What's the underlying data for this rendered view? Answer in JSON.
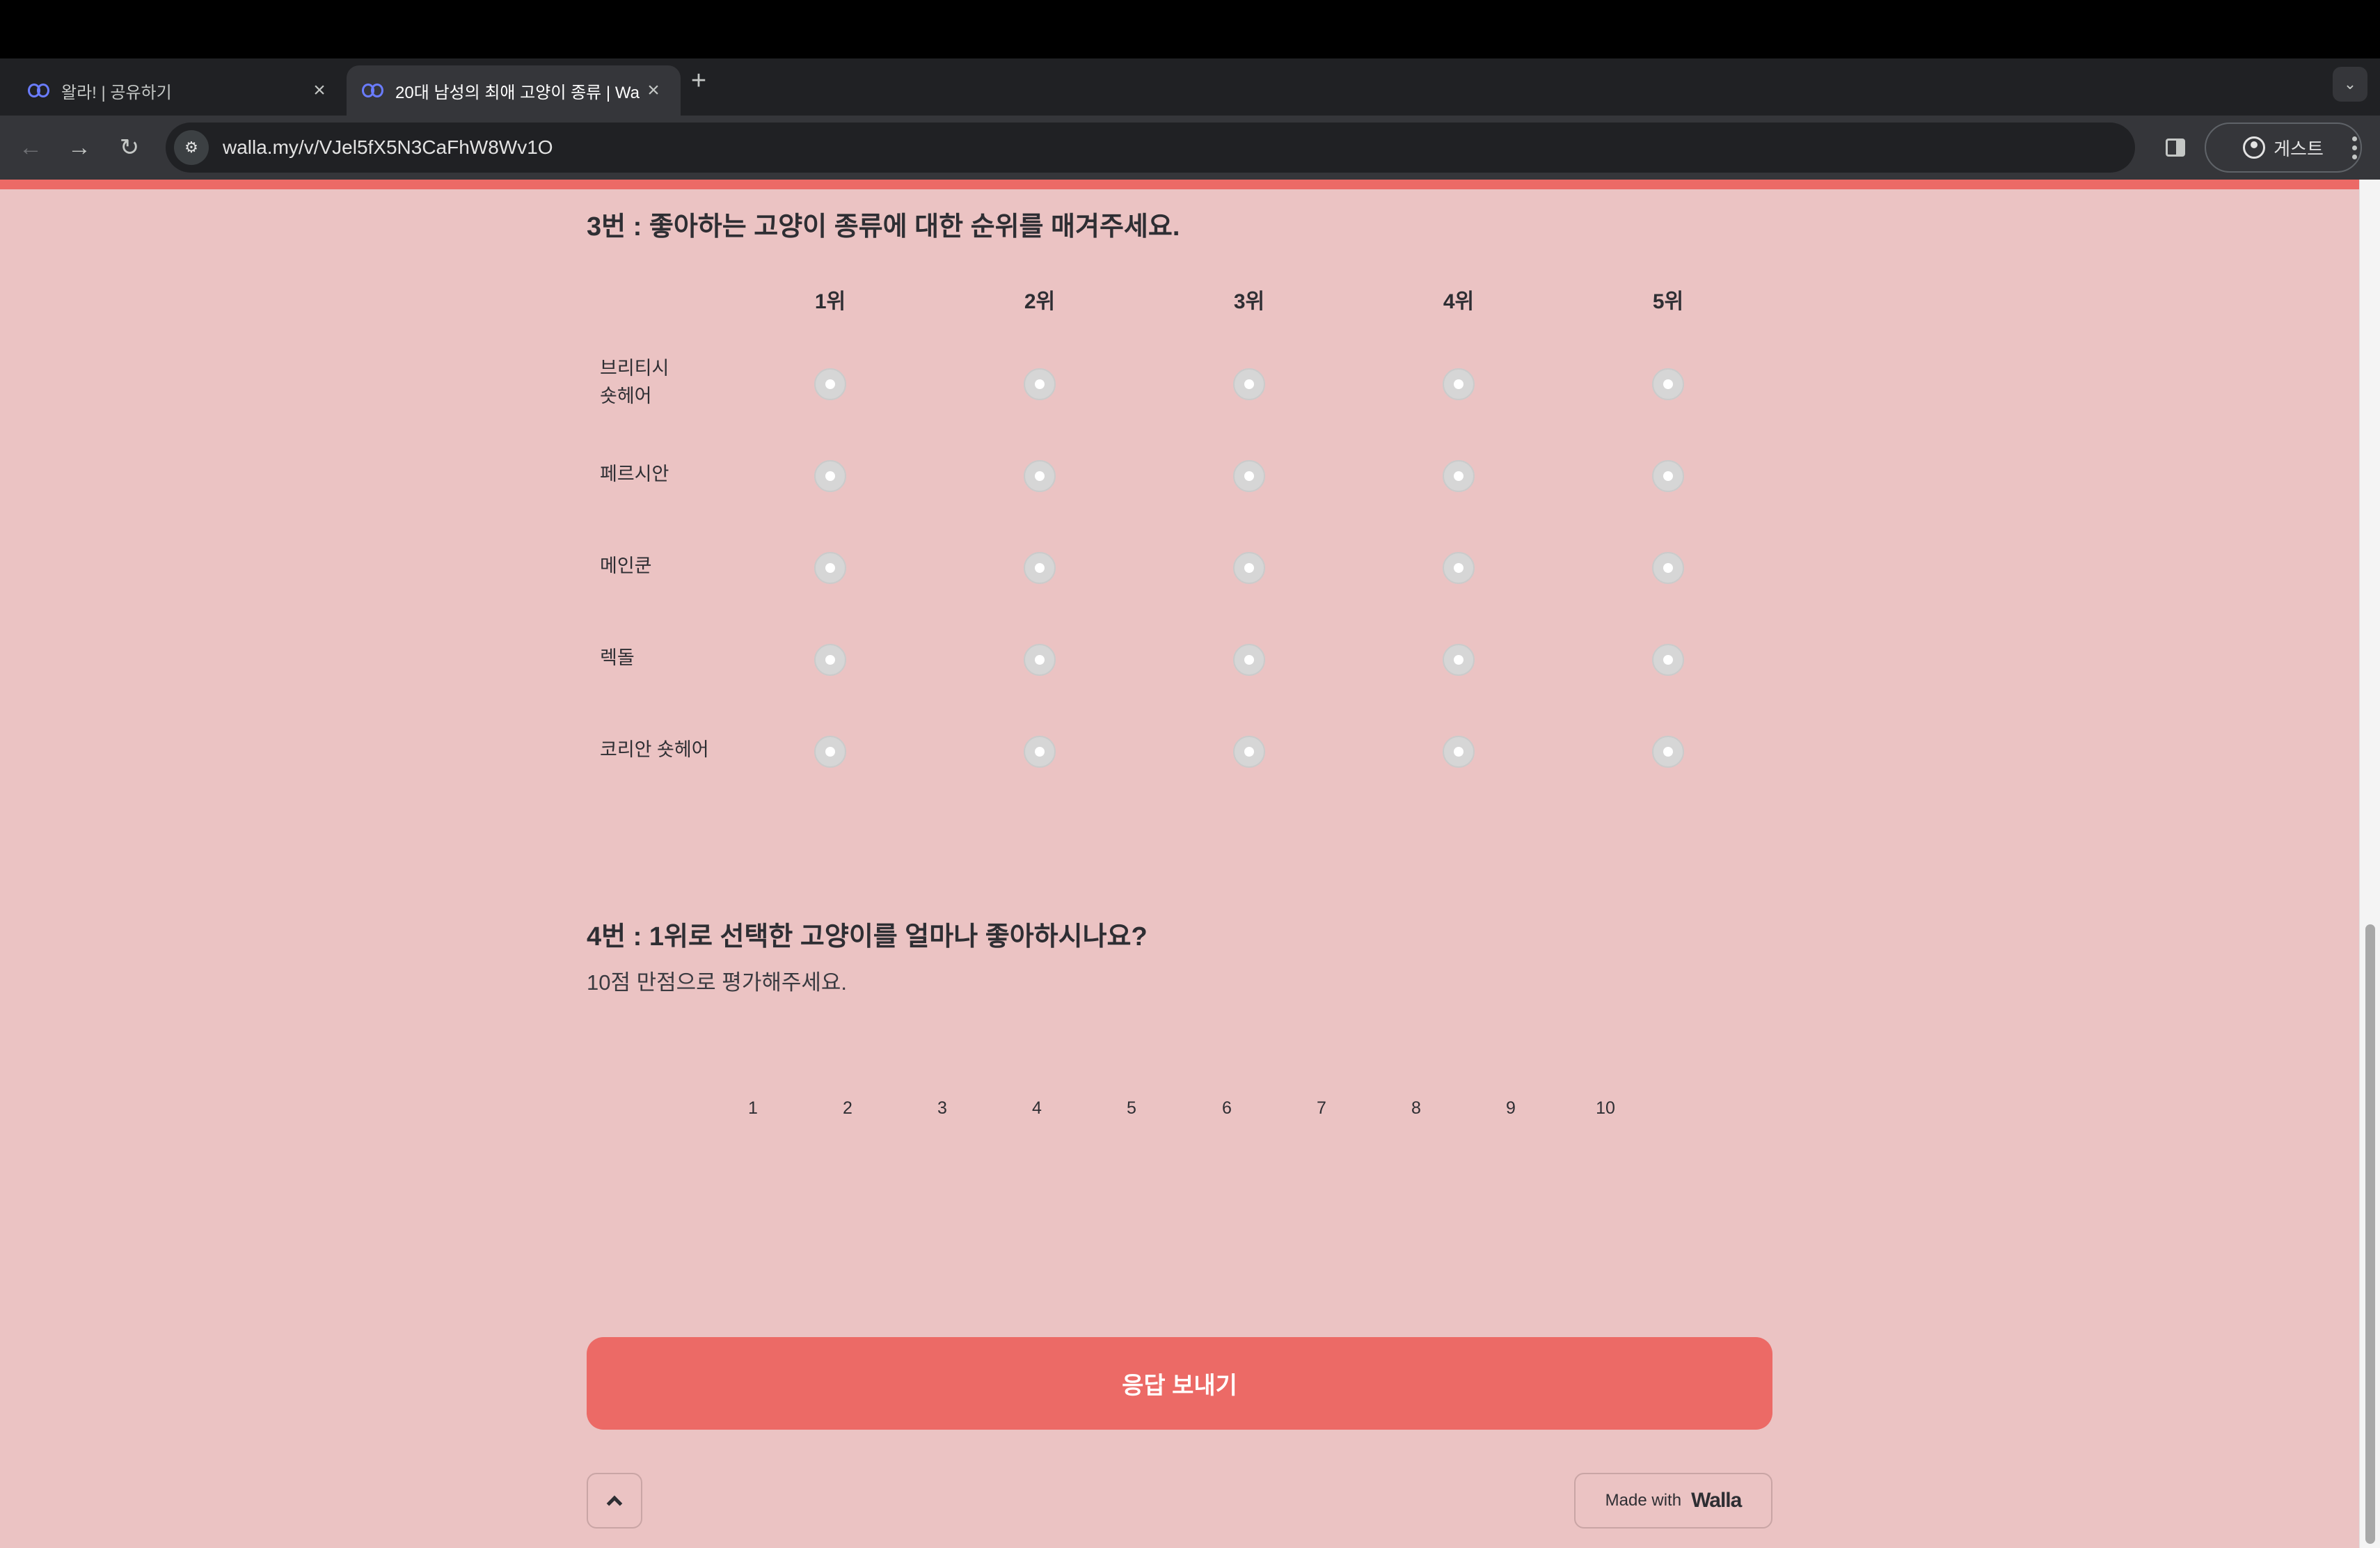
{
  "browser": {
    "tabs": [
      {
        "title": "왈라! | 공유하기",
        "active": false
      },
      {
        "title": "20대 남성의 최애 고양이 종류 | Wa",
        "active": true
      }
    ],
    "new_tab": "+",
    "url": "walla.my/v/VJel5fX5N3CaFhW8Wv1O",
    "profile_label": "게스트"
  },
  "question3": {
    "title": "3번 : 좋아하는 고양이 종류에 대한 순위를 매겨주세요.",
    "columns": [
      "1위",
      "2위",
      "3위",
      "4위",
      "5위"
    ],
    "rows": [
      "브리티시\n숏헤어",
      "페르시안",
      "메인쿤",
      "렉돌",
      "코리안 숏헤어"
    ]
  },
  "question4": {
    "title": "4번 : 1위로 선택한 고양이를 얼마나 좋아하시나요?",
    "subtitle": "10점 만점으로 평가해주세요.",
    "scale": [
      "1",
      "2",
      "3",
      "4",
      "5",
      "6",
      "7",
      "8",
      "9",
      "10"
    ]
  },
  "submit_label": "응답 보내기",
  "footer": {
    "made_with": "Made with",
    "brand": "Walla"
  },
  "colors": {
    "accent": "#ec6a66",
    "page_bg": "#ebc3c3"
  }
}
